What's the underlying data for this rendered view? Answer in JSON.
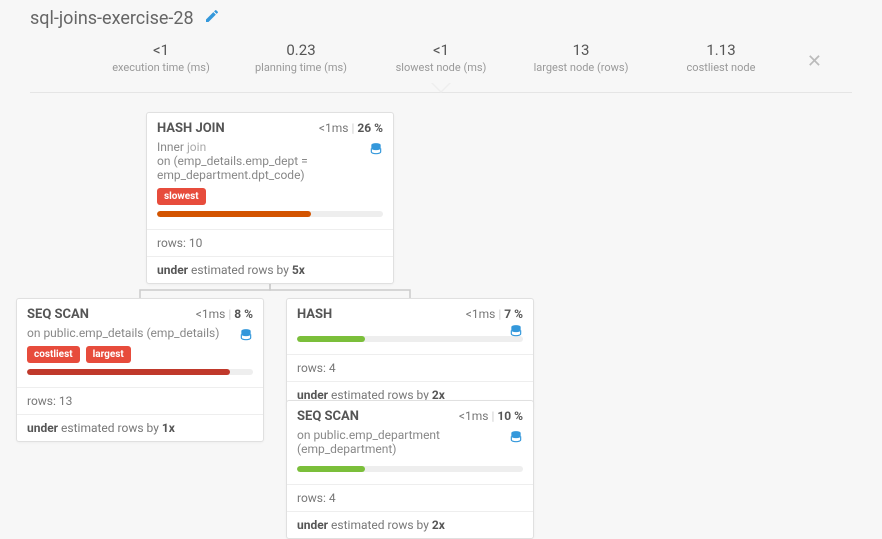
{
  "title": "sql-joins-exercise-28",
  "stats": [
    {
      "value": "<1",
      "label": "execution time (ms)"
    },
    {
      "value": "0.23",
      "label": "planning time (ms)"
    },
    {
      "value": "<1",
      "label": "slowest node (ms)"
    },
    {
      "value": "13",
      "label": "largest node (rows)"
    },
    {
      "value": "1.13",
      "label": "costliest node"
    }
  ],
  "cards": {
    "hashjoin": {
      "title": "HASH JOIN",
      "time": "<1ms",
      "pct": "26 %",
      "join_prefix": "Inner",
      "join_suffix": "join",
      "on_text": "on (emp_details.emp_dept = emp_department.dpt_code)",
      "tags": [
        "slowest"
      ],
      "bar_pct": 68,
      "bar_class": "bar-orange",
      "rows": "rows: 10",
      "est": {
        "prefix": "under",
        "mid": " estimated rows by ",
        "factor": "5x"
      }
    },
    "seqscan1": {
      "title": "SEQ SCAN",
      "time": "<1ms",
      "pct": "8 %",
      "on_text": "on public.emp_details (emp_details)",
      "tags": [
        "costliest",
        "largest"
      ],
      "bar_pct": 90,
      "bar_class": "bar-red",
      "rows": "rows: 13",
      "est": {
        "prefix": "under",
        "mid": " estimated rows by ",
        "factor": "1x"
      }
    },
    "hash": {
      "title": "HASH",
      "time": "<1ms",
      "pct": "7 %",
      "bar_pct": 30,
      "bar_class": "bar-green",
      "rows": "rows: 4",
      "est": {
        "prefix": "under",
        "mid": " estimated rows by ",
        "factor": "2x"
      }
    },
    "seqscan2": {
      "title": "SEQ SCAN",
      "time": "<1ms",
      "pct": "10 %",
      "on_text": "on public.emp_department (emp_department)",
      "bar_pct": 30,
      "bar_class": "bar-green",
      "rows": "rows: 4",
      "est": {
        "prefix": "under",
        "mid": " estimated rows by ",
        "factor": "2x"
      }
    }
  }
}
